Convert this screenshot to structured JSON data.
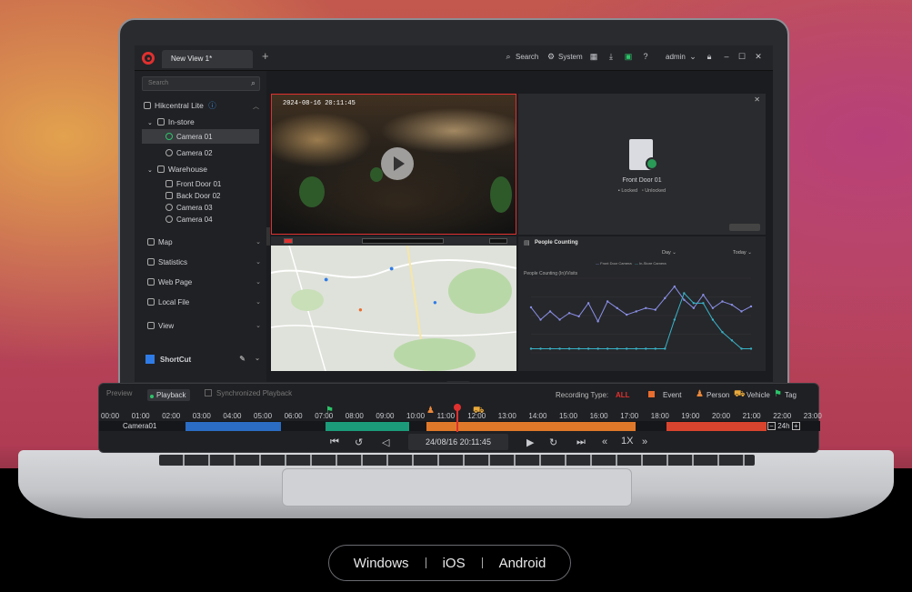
{
  "app": {
    "tab": "New View 1*",
    "add_tab": "+",
    "toolbar": {
      "search": "Search",
      "system": "System",
      "user": "admin"
    }
  },
  "sidebar": {
    "search_placeholder": "Search",
    "root": "Hikcentral Lite",
    "groups": [
      {
        "label": "In-store",
        "items": [
          "Camera 01",
          "Camera 02"
        ]
      },
      {
        "label": "Warehouse",
        "items": [
          "Front Door 01",
          "Back Door 02",
          "Camera 03",
          "Camera 04"
        ]
      }
    ],
    "sections": [
      "Map",
      "Statistics",
      "Web Page",
      "Local File",
      "View"
    ],
    "shortcut": "ShortCut"
  },
  "panes": {
    "video_timestamp": "2024-08-16 20:11:45",
    "door": {
      "name": "Front Door 01",
      "locked": "Locked",
      "unlocked": "Unlocked"
    },
    "people": {
      "title": "People Counting",
      "period": "Day",
      "range": "Today",
      "legend": [
        "Front Door Camera",
        "In-Store Camera"
      ],
      "ylabel": "People Counting (In)/Visits"
    }
  },
  "chart_data": {
    "type": "line",
    "title": "People Counting",
    "ylabel": "People Counting (In)/Visits",
    "x": [
      1,
      2,
      3,
      4,
      5,
      6,
      7,
      8,
      9,
      10,
      11,
      12,
      13,
      14,
      15,
      16,
      17,
      18,
      19,
      20,
      21,
      22,
      23,
      24
    ],
    "series": [
      {
        "name": "Front Door Camera",
        "color": "#8b8fe8",
        "values": [
          55,
          40,
          50,
          40,
          48,
          44,
          60,
          38,
          62,
          54,
          46,
          50,
          54,
          52,
          66,
          80,
          64,
          54,
          70,
          54,
          62,
          58,
          50,
          56
        ]
      },
      {
        "name": "In-Store Camera",
        "color": "#38b2c8",
        "values": [
          5,
          5,
          5,
          5,
          5,
          5,
          5,
          5,
          5,
          5,
          5,
          5,
          5,
          5,
          5,
          40,
          72,
          60,
          60,
          40,
          25,
          15,
          5,
          5
        ]
      }
    ],
    "ylim": [
      0,
      90
    ]
  },
  "playback": {
    "tabs": {
      "preview": "Preview",
      "playback": "Playback",
      "sync": "Synchronized Playback"
    },
    "recording_type_label": "Recording Type:",
    "recording_type_value": "ALL",
    "legend": [
      "Event",
      "Person",
      "Vehicle",
      "Tag"
    ],
    "ticks": [
      "00:00",
      "01:00",
      "02:00",
      "03:00",
      "04:00",
      "05:00",
      "06:00",
      "07:00",
      "08:00",
      "09:00",
      "10:00",
      "11:00",
      "12:00",
      "13:00",
      "14:00",
      "15:00",
      "16:00",
      "17:00",
      "18:00",
      "19:00",
      "20:00",
      "21:00",
      "22:00",
      "23:00"
    ],
    "camera": "Camera01",
    "zoom": "24h",
    "datetime": "24/08/16 20:11:45",
    "speed": "1X",
    "colors": {
      "blue": "#2b6cc4",
      "green": "#1b9b7a",
      "orange": "#e0782a",
      "red": "#d9442e"
    }
  },
  "platforms": [
    "Windows",
    "iOS",
    "Android"
  ]
}
